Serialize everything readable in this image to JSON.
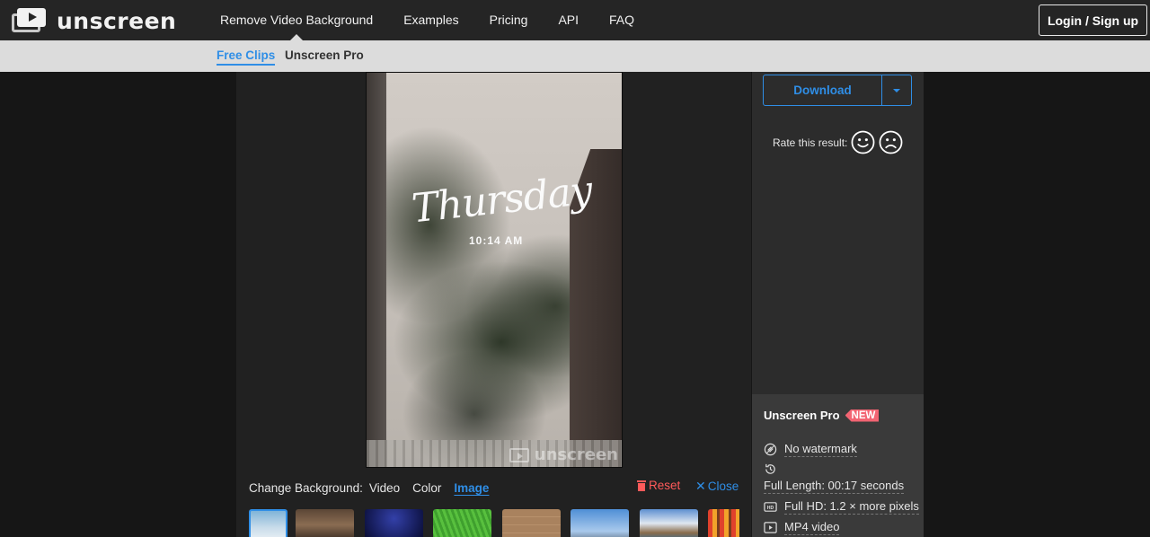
{
  "header": {
    "logo_text": "unscreen",
    "nav": [
      {
        "label": "Remove Video Background",
        "active": true
      },
      {
        "label": "Examples"
      },
      {
        "label": "Pricing"
      },
      {
        "label": "API"
      },
      {
        "label": "FAQ"
      }
    ],
    "login_label": "Login / Sign up"
  },
  "subnav": {
    "tabs": [
      {
        "label": "Free Clips",
        "active": true
      },
      {
        "label": "Unscreen Pro"
      }
    ]
  },
  "video": {
    "overlay_title": "Thursday",
    "overlay_time": "10:14 AM",
    "watermark": "unscreen"
  },
  "background_panel": {
    "label": "Change Background:",
    "options": [
      "Video",
      "Color",
      "Image"
    ],
    "selected": "Image",
    "reset_label": "Reset",
    "close_label": "Close",
    "thumbnails": [
      "sky-clouds",
      "wooden-interior",
      "night-stars",
      "green-grass",
      "wood-planks",
      "city-skyline",
      "mountain-lake",
      "colored-pencils"
    ]
  },
  "sidebar": {
    "download_label": "Download",
    "rate_label": "Rate this result:",
    "pro": {
      "title": "Unscreen Pro",
      "badge": "NEW",
      "features": [
        {
          "icon": "no-watermark-icon",
          "label": "No watermark"
        },
        {
          "icon": "history-icon",
          "label": ""
        },
        {
          "icon": "clock-icon",
          "label": "Full Length: 00:17 seconds"
        },
        {
          "icon": "hd-icon",
          "label": "Full HD: 1.2 × more pixels"
        },
        {
          "icon": "play-file-icon",
          "label": "MP4 video"
        }
      ]
    }
  },
  "colors": {
    "accent": "#2f8ee6",
    "reset": "#ff5a5a",
    "badge": "#f26472",
    "header_bg": "#252525",
    "subbar_bg": "#dcdcdc"
  }
}
